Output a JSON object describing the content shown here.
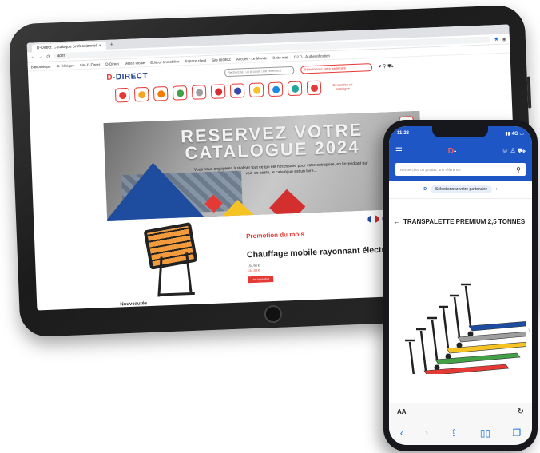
{
  "tablet": {
    "browser": {
      "tab_title": "D-Direct: Catalogue professionnel",
      "new_tab": "+",
      "url": "dd.fr",
      "bookmarks": [
        "Bibliothèque",
        "O. Clinique",
        "Site D-Direct",
        "D-Direct",
        "Météo locale",
        "Editeur Immobilier",
        "Espace client",
        "Site BIOBIZ",
        "Accueil - Le Monde",
        "Boite mail",
        "D2 D - Authentification"
      ]
    },
    "site": {
      "logo_mark": "D",
      "logo_text": "-DIRECT",
      "search_placeholder": "Recherchez un produit, une référence",
      "partner_button": "Sélectionnez votre partenaire",
      "categories": [
        {
          "color": "#e53935"
        },
        {
          "color": "#f2a623"
        },
        {
          "color": "#f57c00"
        },
        {
          "color": "#43a047"
        },
        {
          "color": "#9e9e9e"
        },
        {
          "color": "#d32f2f"
        },
        {
          "color": "#3949ab"
        },
        {
          "color": "#f6c324"
        },
        {
          "color": "#1e88e5"
        },
        {
          "color": "#26a69a"
        },
        {
          "color": "#e53935"
        }
      ],
      "catalog_link": "Demandez un catalogue",
      "hero_title_line1": "RESERVEZ VOTRE",
      "hero_title_line2": "CATALOGUE 2024",
      "hero_subtitle": "Vous nous engagerez à réaliser tout ce qui est nécessaire pour votre entreprise, en l'expédiant par voie de poste, le catalogue est un livre...",
      "promo_label": "Promotion du mois",
      "promo_title": "Chauffage mobile rayonnant électrique",
      "promo_old_price": "154,90 €",
      "promo_price": "134,90 €",
      "promo_button": "Voir le produit",
      "news_heading": "Nouveautés"
    }
  },
  "phone": {
    "status_time": "11:23",
    "status_right": "4G",
    "logo_mark": "D",
    "search_placeholder": "Recherchez un produit, une référence",
    "partner_button": "Sélectionnez votre partenaire",
    "product_title": "TRANSPALETTE PREMIUM 2,5 TONNES",
    "pallet_colors": [
      "#1e4c9e",
      "#9e9e9e",
      "#f6c324",
      "#43a047",
      "#e53935",
      "#f57c00"
    ],
    "reader_label": "AA"
  }
}
